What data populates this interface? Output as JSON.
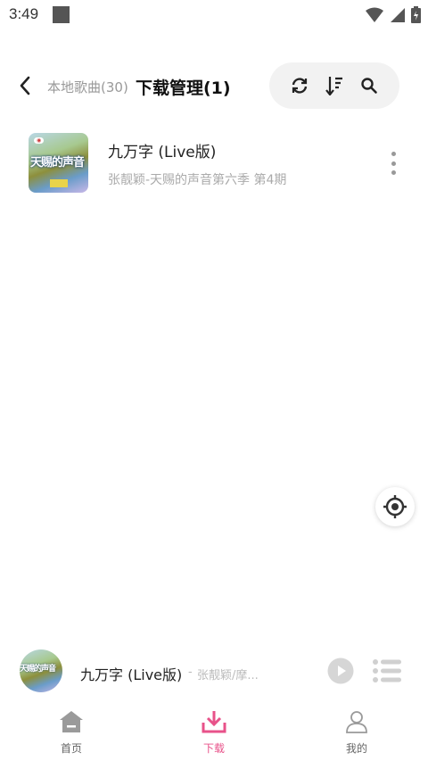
{
  "status_bar": {
    "time": "3:49",
    "icons": [
      "wifi-icon",
      "signal-icon",
      "battery-icon"
    ]
  },
  "header": {
    "back_icon": "chevron-left-icon",
    "tab_local": "本地歌曲(30)",
    "tab_download": "下载管理(1)",
    "tools": [
      "refresh-icon",
      "sort-icon",
      "search-icon"
    ]
  },
  "songs": [
    {
      "title": "九万字 (Live版)",
      "subtitle": "张靓颖-天赐的声音第六季 第4期",
      "cover_text": "天赐的声音"
    }
  ],
  "player": {
    "title": "九万字 (Live版)",
    "separator": "-",
    "artist": "张靓颖/摩..."
  },
  "nav": {
    "items": [
      {
        "label": "首页",
        "icon": "home-icon"
      },
      {
        "label": "下载",
        "icon": "download-icon"
      },
      {
        "label": "我的",
        "icon": "user-icon"
      }
    ],
    "active_index": 1
  },
  "colors": {
    "accent": "#e8528a",
    "muted_text": "#aaaaaa",
    "pill_bg": "#f2f2f2"
  }
}
